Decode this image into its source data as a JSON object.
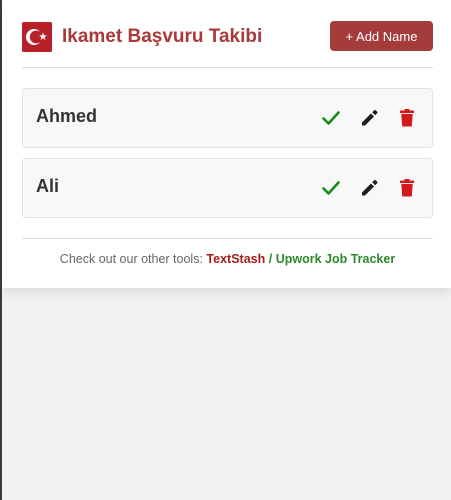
{
  "header": {
    "title": "Ikamet Başvuru Takibi",
    "add_button_label": "+ Add Name",
    "logo_icon": "turkish-flag-icon"
  },
  "names": [
    {
      "label": "Ahmed"
    },
    {
      "label": "Ali"
    }
  ],
  "row_actions": [
    "check-icon",
    "pencil-icon",
    "trash-icon"
  ],
  "footer": {
    "prefix": "Check out our other tools:",
    "link1": "TextStash",
    "separator": "/",
    "link2": "Upwork Job Tracker"
  },
  "colors": {
    "accent": "#a43c3c",
    "title": "#a83a3a",
    "check": "#1a8a1a",
    "trash": "#d11a1a",
    "link1": "#a61c1c",
    "link2": "#2a8a2a"
  }
}
